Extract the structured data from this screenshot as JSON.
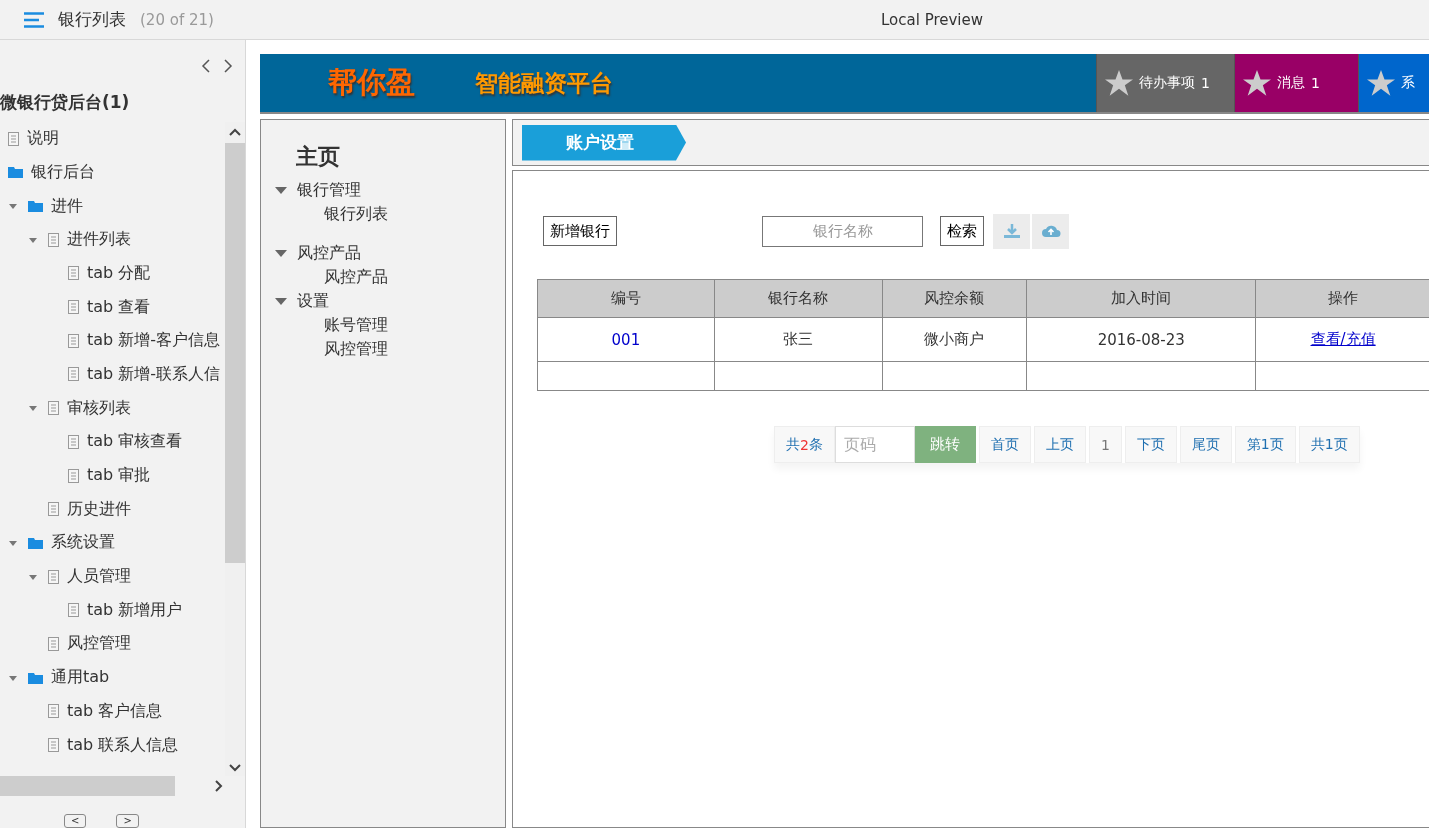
{
  "window": {
    "page_title": "银行列表",
    "page_count": "(20 of 21)",
    "title": "Local Preview"
  },
  "sidebar": {
    "title": "微银行贷后台(1)",
    "tree": [
      {
        "label": "说明",
        "kind": "page"
      },
      {
        "label": "银行后台",
        "kind": "folder"
      },
      {
        "label": "进件",
        "kind": "folder",
        "expanded": true,
        "children": [
          {
            "label": "进件列表",
            "kind": "page",
            "expanded": true,
            "children": [
              {
                "label": "tab 分配",
                "kind": "page"
              },
              {
                "label": "tab 查看",
                "kind": "page"
              },
              {
                "label": "tab 新增-客户信息",
                "kind": "page"
              },
              {
                "label": "tab 新增-联系人信",
                "kind": "page"
              }
            ]
          },
          {
            "label": "审核列表",
            "kind": "page",
            "expanded": true,
            "children": [
              {
                "label": "tab 审核查看",
                "kind": "page"
              },
              {
                "label": "tab 审批",
                "kind": "page"
              }
            ]
          },
          {
            "label": "历史进件",
            "kind": "page"
          }
        ]
      },
      {
        "label": "系统设置",
        "kind": "folder",
        "expanded": true,
        "children": [
          {
            "label": "人员管理",
            "kind": "page",
            "expanded": true,
            "children": [
              {
                "label": "tab 新增用户",
                "kind": "page"
              }
            ]
          },
          {
            "label": "风控管理",
            "kind": "page"
          }
        ]
      },
      {
        "label": "通用tab",
        "kind": "folder",
        "expanded": true,
        "children": [
          {
            "label": "tab 客户信息",
            "kind": "page"
          },
          {
            "label": "tab 联系人信息",
            "kind": "page"
          }
        ]
      }
    ],
    "keys": [
      "<",
      ">"
    ]
  },
  "app": {
    "logo": "帮你盈",
    "subtitle": "智能融资平台",
    "header_items": [
      {
        "label": "待办事项",
        "count": "1",
        "color": "#666666"
      },
      {
        "label": "消息",
        "count": "1",
        "color": "#990066"
      },
      {
        "label": "系",
        "color": "#0066cc"
      }
    ],
    "nav": {
      "title": "主页",
      "groups": [
        {
          "label": "银行管理",
          "expanded": true,
          "children": [
            "银行列表"
          ]
        },
        {
          "label": "风控产品",
          "expanded": true,
          "children": [
            "风控产品"
          ]
        },
        {
          "label": "设置",
          "expanded": true,
          "children": [
            "账号管理",
            "风控管理"
          ]
        }
      ]
    },
    "breadcrumb": "账户设置",
    "toolbar": {
      "add_button": "新增银行",
      "search": {
        "placeholder": "银行名称"
      },
      "search_button": "检索"
    },
    "table": {
      "columns": [
        "编号",
        "银行名称",
        "风控余额",
        "加入时间",
        "操作"
      ],
      "rows": [
        {
          "id": "001",
          "name": "张三",
          "balance": "微小商户",
          "joined": "2016-08-23",
          "action": "查看/充值"
        }
      ]
    },
    "pager": {
      "total": {
        "before": "共",
        "count": "2",
        "after": "条"
      },
      "page_input": {
        "placeholder": "页码"
      },
      "jump": "跳转",
      "links": [
        {
          "label": "首页",
          "selected": false
        },
        {
          "label": "上页",
          "selected": false
        },
        {
          "label": "1",
          "selected": true
        },
        {
          "label": "下页",
          "selected": false
        },
        {
          "label": "尾页",
          "selected": false
        },
        {
          "label": "第1页",
          "selected": false
        },
        {
          "label": "共1页",
          "selected": false
        }
      ]
    }
  }
}
